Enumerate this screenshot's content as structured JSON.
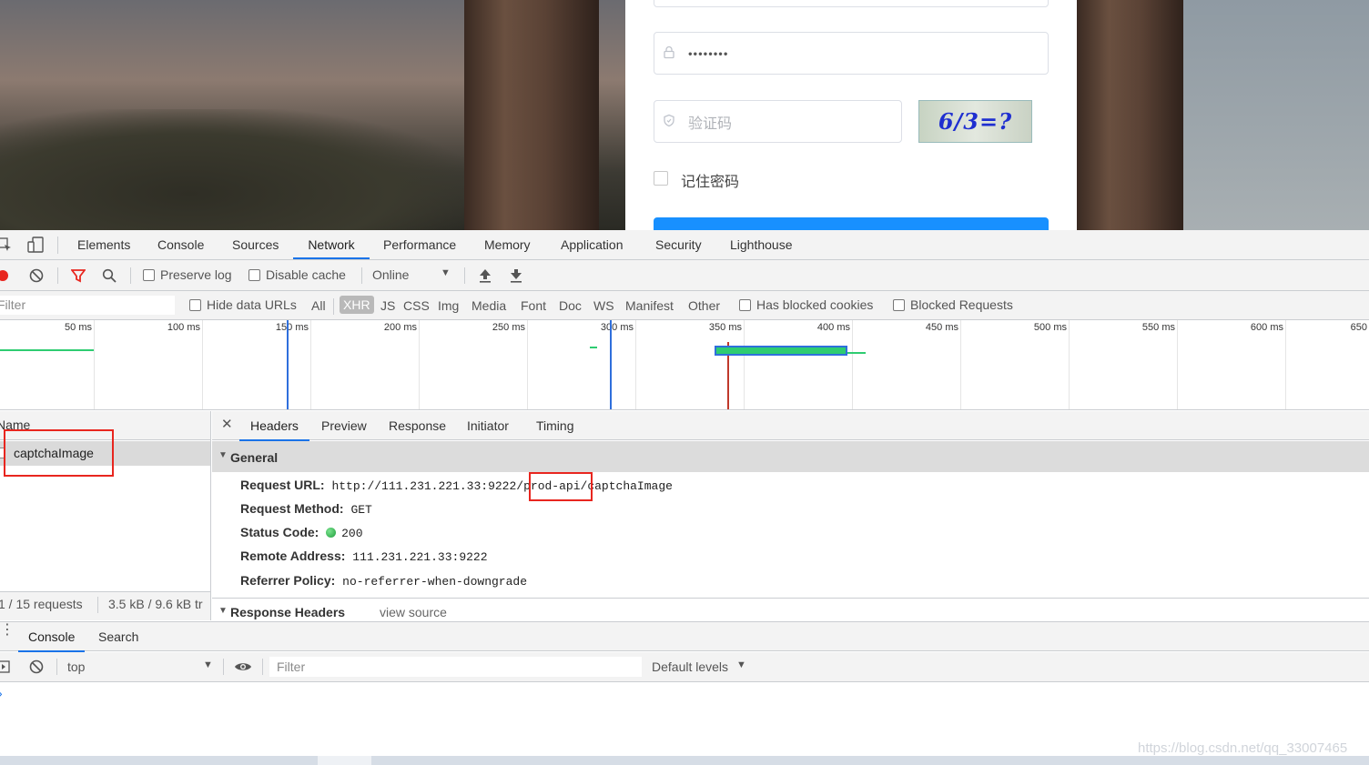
{
  "login": {
    "password_mask": "••••••••",
    "captcha_placeholder": "验证码",
    "captcha_image_text": "6/3=?",
    "remember_label": "记住密码"
  },
  "devtools": {
    "tabs": [
      "Elements",
      "Console",
      "Sources",
      "Network",
      "Performance",
      "Memory",
      "Application",
      "Security",
      "Lighthouse"
    ],
    "active_tab": "Network",
    "toolbar": {
      "preserve_log": "Preserve log",
      "disable_cache": "Disable cache",
      "throttle": "Online"
    },
    "filter": {
      "placeholder": "Filter",
      "hide_data_urls": "Hide data URLs",
      "types": [
        "All",
        "XHR",
        "JS",
        "CSS",
        "Img",
        "Media",
        "Font",
        "Doc",
        "WS",
        "Manifest",
        "Other"
      ],
      "active_type": "XHR",
      "has_blocked_cookies": "Has blocked cookies",
      "blocked_requests": "Blocked Requests"
    },
    "timeline_ticks": [
      "50 ms",
      "100 ms",
      "150 ms",
      "200 ms",
      "250 ms",
      "300 ms",
      "350 ms",
      "400 ms",
      "450 ms",
      "500 ms",
      "550 ms",
      "600 ms",
      "650"
    ],
    "requests": {
      "column_name": "Name",
      "rows": [
        "captchaImage"
      ],
      "summary_count": "1 / 15 requests",
      "summary_size": "3.5 kB / 9.6 kB tr"
    },
    "detail_tabs": [
      "Headers",
      "Preview",
      "Response",
      "Initiator",
      "Timing"
    ],
    "active_detail_tab": "Headers",
    "general": {
      "title": "General",
      "request_url_label": "Request URL:",
      "request_url_prefix": "http://111.231.221.33:9222/",
      "request_url_highlight": "prod-api",
      "request_url_suffix": "/captchaImage",
      "request_method_label": "Request Method:",
      "request_method": "GET",
      "status_code_label": "Status Code:",
      "status_code": "200",
      "remote_address_label": "Remote Address:",
      "remote_address": "111.231.221.33:9222",
      "referrer_policy_label": "Referrer Policy:",
      "referrer_policy": "no-referrer-when-downgrade"
    },
    "response_headers": {
      "title": "Response Headers",
      "view_source": "view source"
    },
    "drawer": {
      "tabs": [
        "Console",
        "Search"
      ],
      "context": "top",
      "filter_placeholder": "Filter",
      "levels": "Default levels"
    }
  },
  "watermark": "https://blog.csdn.net/qq_33007465",
  "colors": {
    "accent": "#1a73e8",
    "highlight_box": "#e8261f",
    "status_ok": "#24b34a",
    "login_button": "#1890ff"
  }
}
